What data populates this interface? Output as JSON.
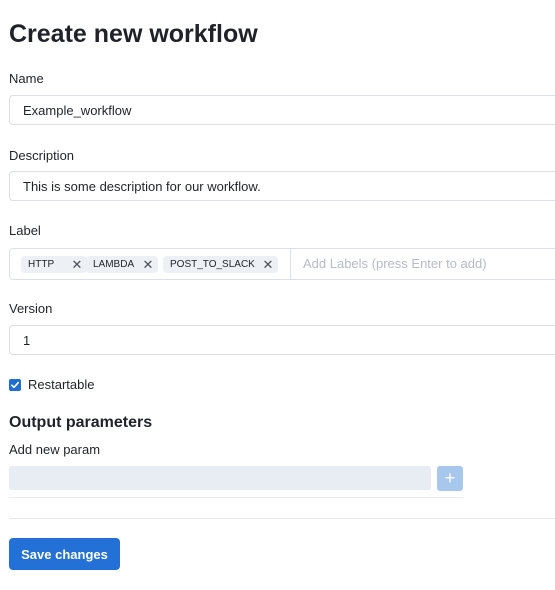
{
  "page": {
    "title": "Create new workflow"
  },
  "form": {
    "name": {
      "label": "Name",
      "value": "Example_workflow"
    },
    "description": {
      "label": "Description",
      "value": "This is some description for our workflow."
    },
    "labels": {
      "label": "Label",
      "tags": [
        "HTTP",
        "LAMBDA",
        "POST_TO_SLACK"
      ],
      "remove_icon": "close-icon",
      "placeholder": "Add Labels (press Enter to add)"
    },
    "version": {
      "label": "Version",
      "value": "1"
    },
    "restartable": {
      "label": "Restartable",
      "checked": true
    }
  },
  "output_parameters": {
    "heading": "Output parameters",
    "add_label": "Add new param",
    "param_value": "",
    "add_button_icon": "plus-icon"
  },
  "actions": {
    "save_label": "Save changes"
  },
  "colors": {
    "primary": "#2371d6",
    "add_button_disabled": "#a7c8ec",
    "tag_background": "#edf0f4",
    "border": "#dcdfe3"
  }
}
